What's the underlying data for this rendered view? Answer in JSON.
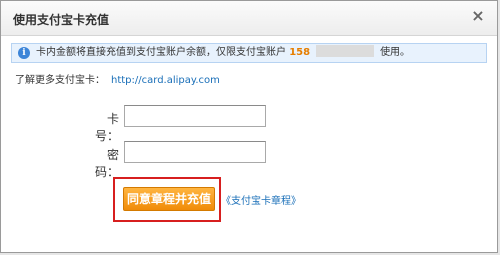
{
  "dialog": {
    "title": "使用支付宝卡充值",
    "close_symbol": "×"
  },
  "notice": {
    "icon": "info-icon",
    "icon_glyph": "i",
    "text_before": "卡内金额将直接充值到支付宝账户余额，仅限支付宝账户",
    "account_prefix": "158",
    "text_after": "使用。"
  },
  "learn_more": {
    "label": "了解更多支付宝卡：",
    "url_text": "http://card.alipay.com"
  },
  "form": {
    "card_number_label": "卡号：",
    "card_number_value": "",
    "password_label": "密码：",
    "password_value": ""
  },
  "actions": {
    "submit_label": "同意章程并充值",
    "terms_link": "《支付宝卡章程》"
  },
  "colors": {
    "accent_orange": "#f08b08",
    "link_blue": "#1a6fb8",
    "highlight_red": "#d71f1f",
    "notice_bg": "#e8f2fd"
  }
}
